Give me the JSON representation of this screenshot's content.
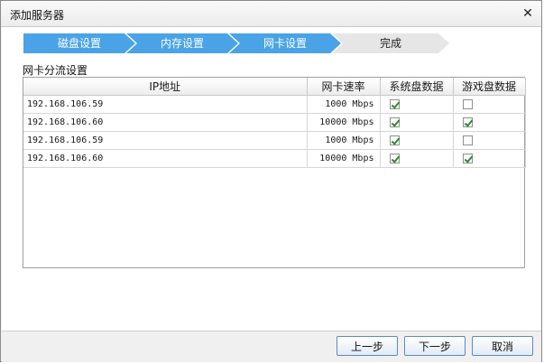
{
  "window": {
    "title": "添加服务器",
    "close_icon": "close-icon"
  },
  "steps": [
    {
      "label": "磁盘设置",
      "state": "done"
    },
    {
      "label": "内存设置",
      "state": "done"
    },
    {
      "label": "网卡设置",
      "state": "current"
    },
    {
      "label": "完成",
      "state": "pending"
    }
  ],
  "colors": {
    "step_active": "#4aa3e6",
    "step_inactive": "#e6e6e6",
    "check_mark": "#2a8a2a",
    "button_border": "#5b8bc0"
  },
  "section": {
    "label": "网卡分流设置"
  },
  "table": {
    "columns": [
      "IP地址",
      "网卡速率",
      "系统盘数据",
      "游戏盘数据"
    ],
    "rows": [
      {
        "ip": "192.168.106.59",
        "speed": "1000 Mbps",
        "system": true,
        "game": false
      },
      {
        "ip": "192.168.106.60",
        "speed": "10000 Mbps",
        "system": true,
        "game": true
      },
      {
        "ip": "192.168.106.59",
        "speed": "1000 Mbps",
        "system": true,
        "game": false
      },
      {
        "ip": "192.168.106.60",
        "speed": "10000 Mbps",
        "system": true,
        "game": true
      }
    ]
  },
  "buttons": {
    "prev": "上一步",
    "next": "下一步",
    "cancel": "取消"
  }
}
